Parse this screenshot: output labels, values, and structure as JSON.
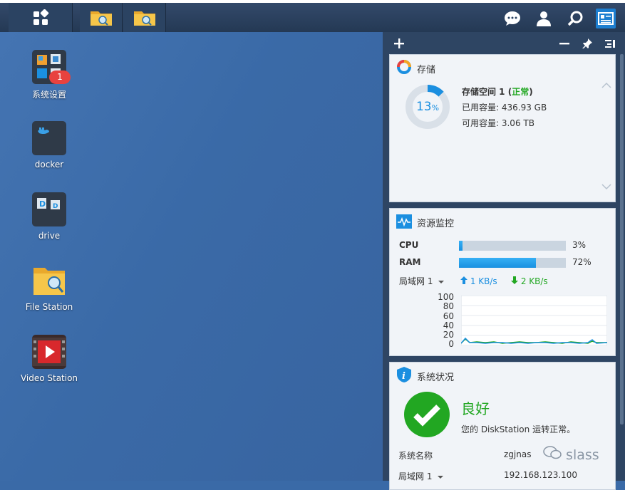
{
  "desktop_apps": [
    {
      "label": "系统设置",
      "badge": "1"
    },
    {
      "label": "docker"
    },
    {
      "label": "drive"
    },
    {
      "label": "File Station"
    },
    {
      "label": "Video Station"
    }
  ],
  "storage": {
    "title": "存储",
    "percent": "13",
    "percent_unit": "%",
    "volume_name": "存储空间 1 (",
    "volume_status": "正常",
    "volume_close": ")",
    "used": "已用容量: 436.93 GB",
    "free": "可用容量: 3.06 TB"
  },
  "monitor": {
    "title": "资源监控",
    "cpu_label": "CPU",
    "cpu_value": "3%",
    "cpu_frac": 0.03,
    "ram_label": "RAM",
    "ram_value": "72%",
    "ram_frac": 0.72,
    "net_label": "局域网 1",
    "upload": "1 KB/s",
    "download": "2 KB/s",
    "y_ticks": [
      "100",
      "80",
      "60",
      "40",
      "20",
      "0"
    ]
  },
  "status": {
    "title": "系统状况",
    "state": "良好",
    "message": "您的 DiskStation 运转正常。",
    "name_label": "系统名称",
    "name_value": "zgjnas",
    "lan_label": "局域网 1",
    "lan_value": "192.168.123.100"
  },
  "watermark": "slass",
  "colors": {
    "accent": "#1b8fe0",
    "ok": "#22a722",
    "badge": "#e8423f"
  }
}
